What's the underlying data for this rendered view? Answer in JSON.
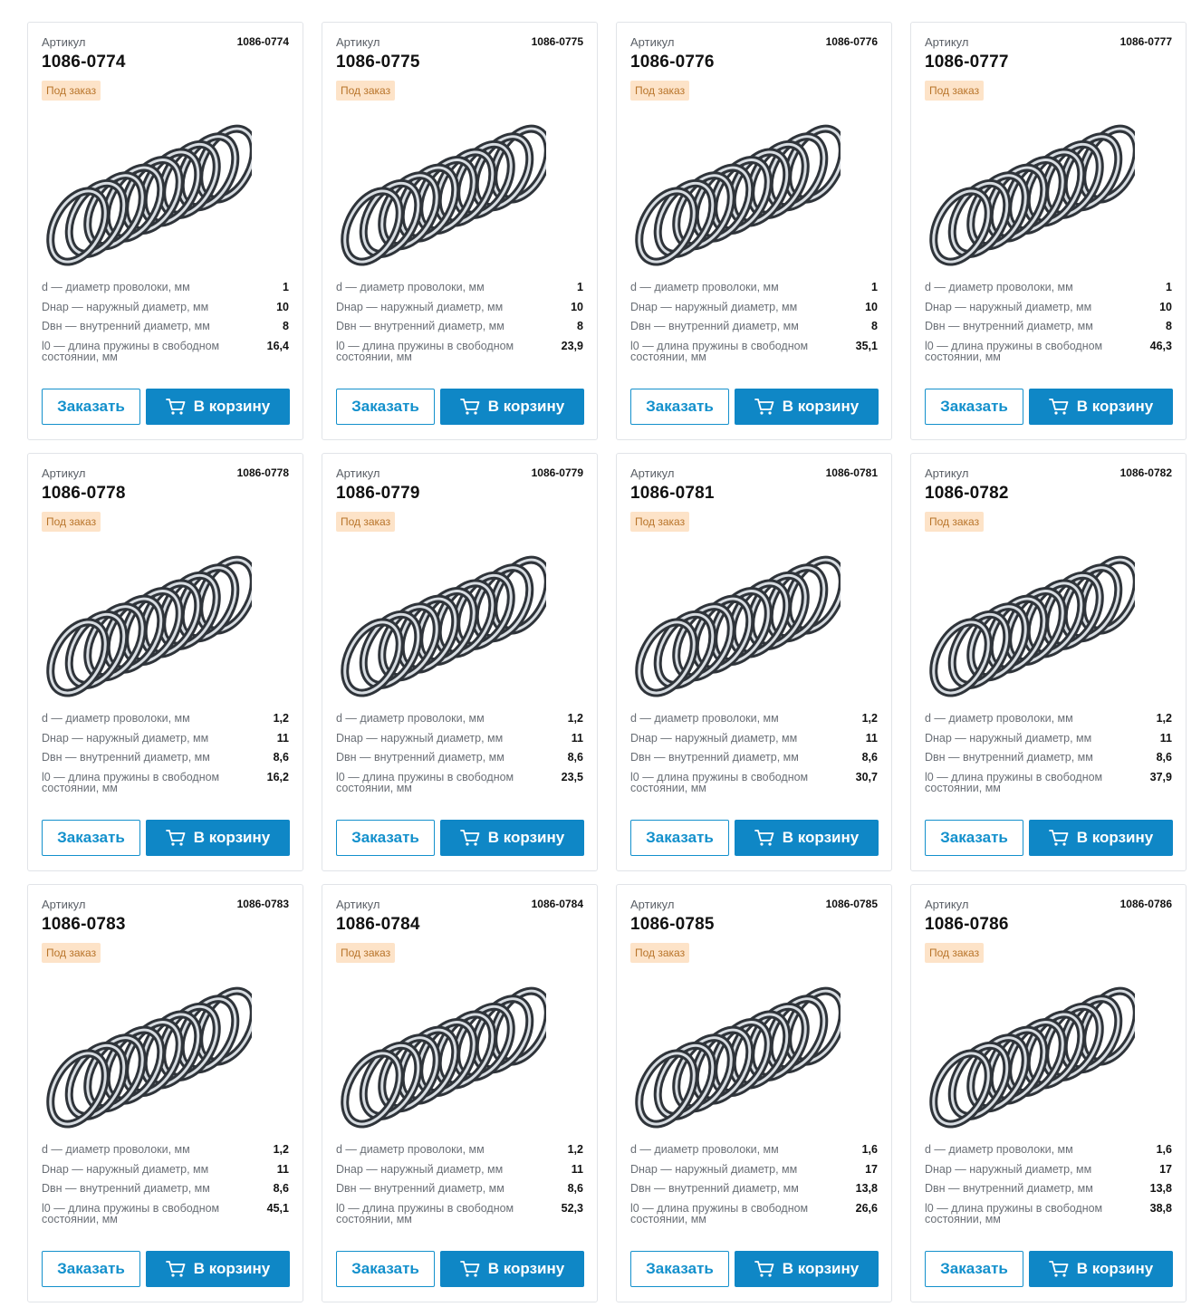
{
  "labels": {
    "article": "Артикул",
    "badge": "Под заказ",
    "spec_d": "d — диаметр проволоки, мм",
    "spec_dnar": "Dнар — наружный диаметр, мм",
    "spec_dvn": "Dвн — внутренний диаметр, мм",
    "spec_l0": "l0 — длина пружины в свободном состоянии, мм",
    "order_button": "Заказать",
    "cart_button": "В корзину"
  },
  "icons": {
    "cart": "cart-icon",
    "product": "spring-image"
  },
  "colors": {
    "accent": "#0f87c6",
    "badge_bg": "#fde3c8",
    "badge_text": "#b8742a"
  },
  "products": [
    {
      "code": "1086-0774",
      "d": "1",
      "dnar": "10",
      "dvn": "8",
      "l0": "16,4"
    },
    {
      "code": "1086-0775",
      "d": "1",
      "dnar": "10",
      "dvn": "8",
      "l0": "23,9"
    },
    {
      "code": "1086-0776",
      "d": "1",
      "dnar": "10",
      "dvn": "8",
      "l0": "35,1"
    },
    {
      "code": "1086-0777",
      "d": "1",
      "dnar": "10",
      "dvn": "8",
      "l0": "46,3"
    },
    {
      "code": "1086-0778",
      "d": "1,2",
      "dnar": "11",
      "dvn": "8,6",
      "l0": "16,2"
    },
    {
      "code": "1086-0779",
      "d": "1,2",
      "dnar": "11",
      "dvn": "8,6",
      "l0": "23,5"
    },
    {
      "code": "1086-0781",
      "d": "1,2",
      "dnar": "11",
      "dvn": "8,6",
      "l0": "30,7"
    },
    {
      "code": "1086-0782",
      "d": "1,2",
      "dnar": "11",
      "dvn": "8,6",
      "l0": "37,9"
    },
    {
      "code": "1086-0783",
      "d": "1,2",
      "dnar": "11",
      "dvn": "8,6",
      "l0": "45,1"
    },
    {
      "code": "1086-0784",
      "d": "1,2",
      "dnar": "11",
      "dvn": "8,6",
      "l0": "52,3"
    },
    {
      "code": "1086-0785",
      "d": "1,6",
      "dnar": "17",
      "dvn": "13,8",
      "l0": "26,6"
    },
    {
      "code": "1086-0786",
      "d": "1,6",
      "dnar": "17",
      "dvn": "13,8",
      "l0": "38,8"
    }
  ]
}
